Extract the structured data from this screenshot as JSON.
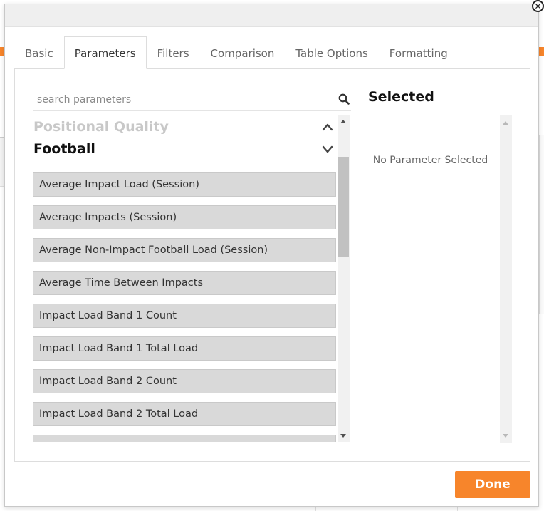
{
  "tabs": [
    {
      "label": "Basic",
      "active": false
    },
    {
      "label": "Parameters",
      "active": true
    },
    {
      "label": "Filters",
      "active": false
    },
    {
      "label": "Comparison",
      "active": false
    },
    {
      "label": "Table Options",
      "active": false
    },
    {
      "label": "Formatting",
      "active": false
    }
  ],
  "search": {
    "placeholder": "search parameters",
    "value": ""
  },
  "groups": {
    "previous": "Positional Quality",
    "current": "Football"
  },
  "parameters": [
    "Average Impact Load (Session)",
    "Average Impacts (Session)",
    "Average Non-Impact Football Load (Session)",
    "Average Time Between Impacts",
    "Impact Load Band 1 Count",
    "Impact Load Band 1 Total Load",
    "Impact Load Band 2 Count",
    "Impact Load Band 2 Total Load",
    ""
  ],
  "selected": {
    "title": "Selected",
    "empty_text": "No Parameter Selected"
  },
  "footer": {
    "done_label": "Done"
  },
  "colors": {
    "accent": "#f7852b",
    "item_bg": "#d9d9d9"
  },
  "icons": {
    "close": "close-icon",
    "search": "search-icon",
    "collapse": "chevron-up-icon",
    "expand": "chevron-down-icon"
  }
}
